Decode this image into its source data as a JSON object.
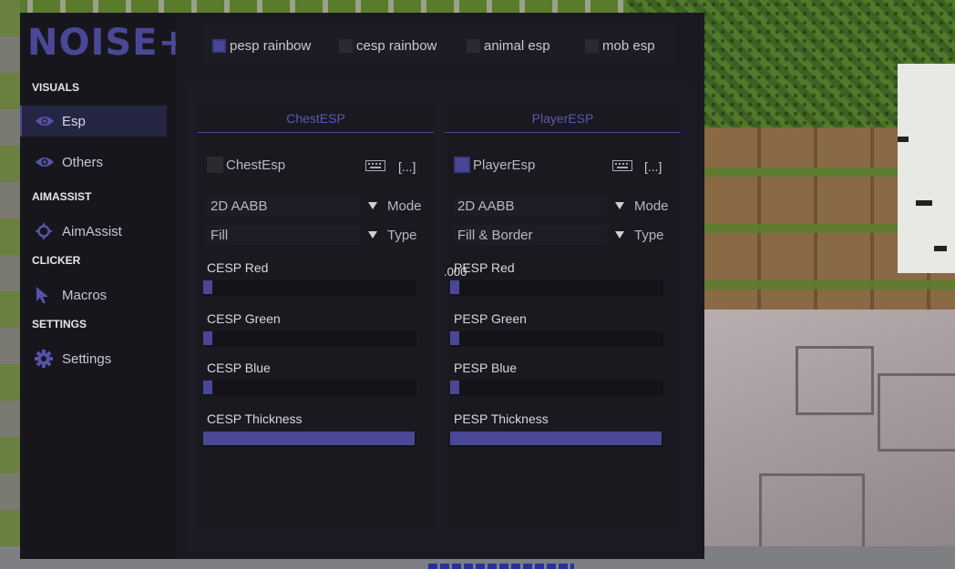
{
  "app": {
    "title": "NOISE+"
  },
  "sidebar": {
    "sections": [
      {
        "title": "VISUALS",
        "items": [
          {
            "label": "Esp",
            "icon": "eye-icon",
            "active": true
          },
          {
            "label": "Others",
            "icon": "eye-icon"
          }
        ]
      },
      {
        "title": "AIMASSIST",
        "items": [
          {
            "label": "AimAssist",
            "icon": "crosshair-icon"
          }
        ]
      },
      {
        "title": "CLICKER",
        "items": [
          {
            "label": "Macros",
            "icon": "cursor-icon"
          }
        ]
      },
      {
        "title": "SETTINGS",
        "items": [
          {
            "label": "Settings",
            "icon": "gear-icon"
          }
        ]
      }
    ]
  },
  "topbar": {
    "checks": [
      {
        "label": "pesp rainbow",
        "checked": true
      },
      {
        "label": "cesp rainbow",
        "checked": false
      },
      {
        "label": "animal esp",
        "checked": false
      },
      {
        "label": "mob esp",
        "checked": false
      }
    ]
  },
  "panels": [
    {
      "title": "ChestESP",
      "enable": {
        "label": "ChestEsp",
        "checked": false
      },
      "bind": "[...]",
      "selects": [
        {
          "value": "2D AABB",
          "name": "Mode"
        },
        {
          "value": "Fill",
          "name": "Type"
        }
      ],
      "sliders": [
        {
          "label": "CESP Red",
          "fraction": 0.04
        },
        {
          "label": "CESP Green",
          "fraction": 0.04
        },
        {
          "label": "CESP Blue",
          "fraction": 0.04
        },
        {
          "label": "CESP Thickness",
          "fraction": 1.0
        }
      ]
    },
    {
      "title": "PlayerESP",
      "enable": {
        "label": "PlayerEsp",
        "checked": true
      },
      "bind": "[...]",
      "selects": [
        {
          "value": "2D AABB",
          "name": "Mode"
        },
        {
          "value": "Fill & Border",
          "name": "Type"
        }
      ],
      "sliders": [
        {
          "label": "PESP Red",
          "fraction": 0.04
        },
        {
          "label": "PESP Green",
          "fraction": 0.04
        },
        {
          "label": "PESP Blue",
          "fraction": 0.04
        },
        {
          "label": "PESP Thickness",
          "fraction": 1.0
        }
      ]
    }
  ],
  "overlay": {
    "stray_value": ".000"
  },
  "colors": {
    "accent": "#4a4896",
    "bg": "#16151c",
    "text": "#c8c8d0"
  }
}
